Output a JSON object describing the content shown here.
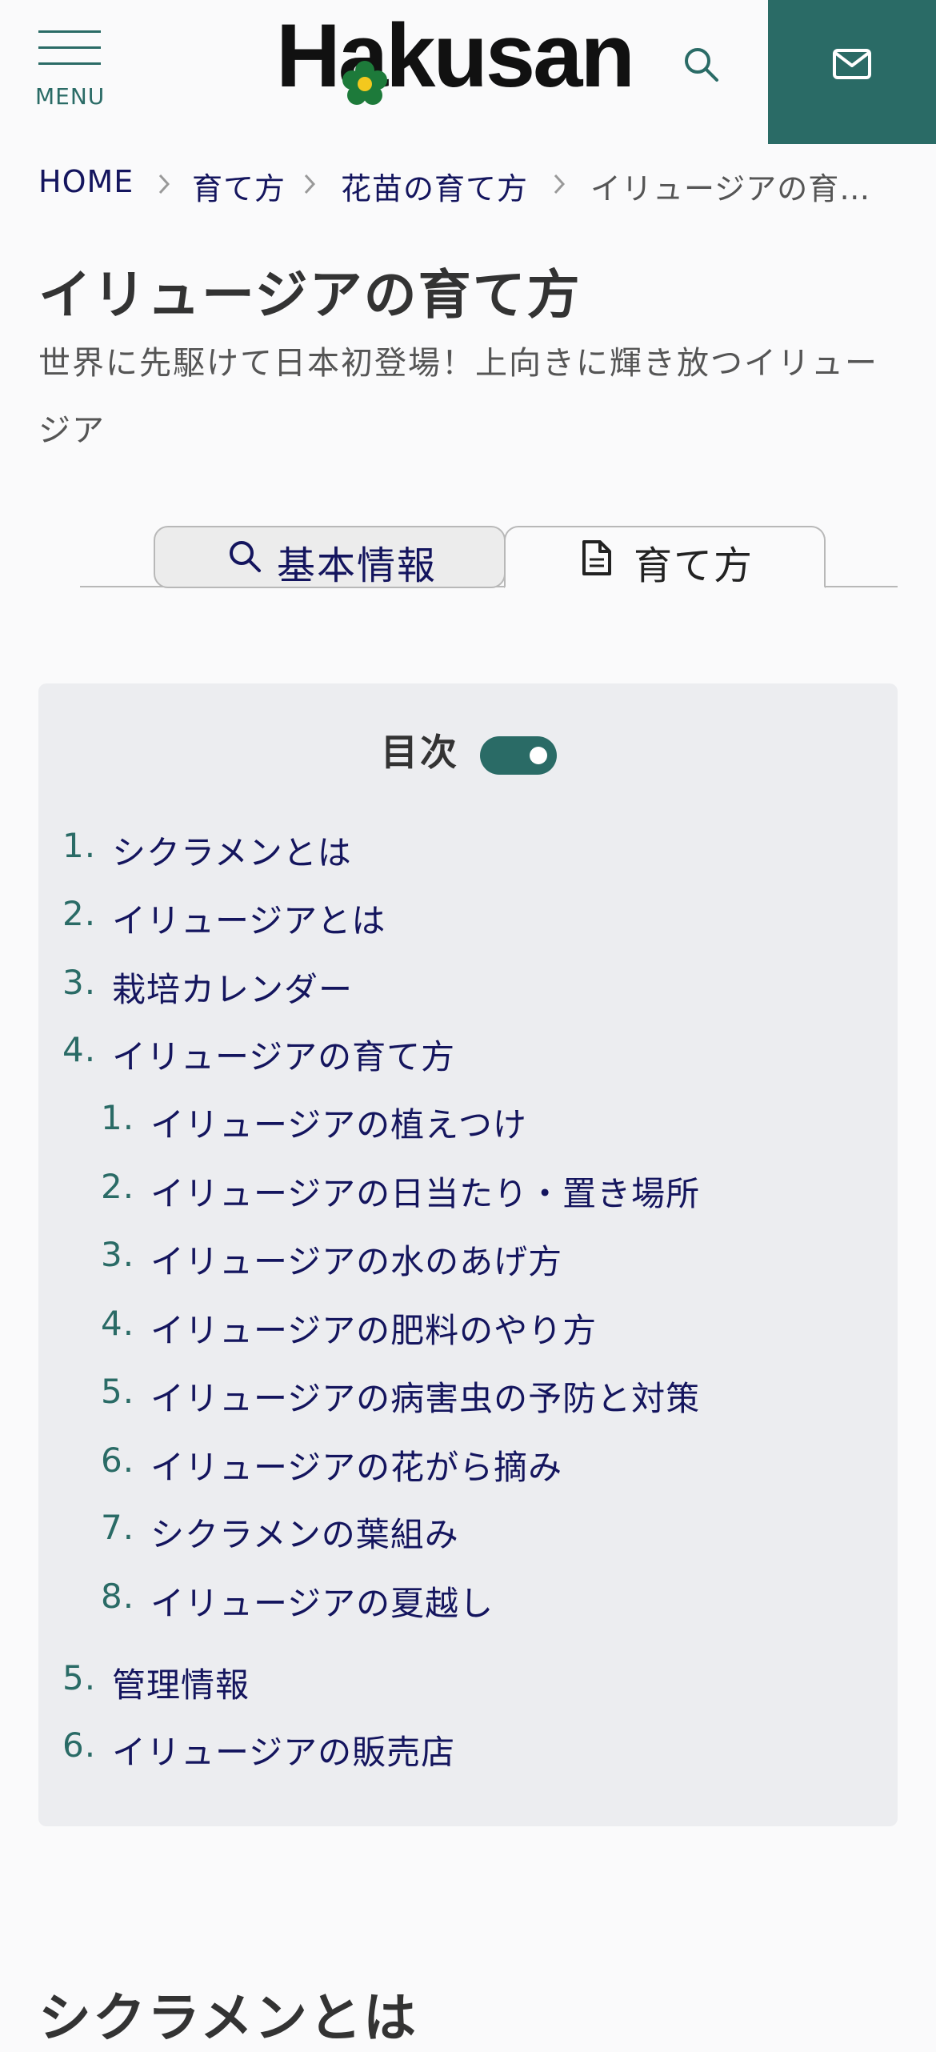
{
  "header": {
    "menu_label": "MENU",
    "logo_text": "Hakusan",
    "brand_color": "#2a6b66",
    "icons": [
      "menu-icon",
      "search-icon",
      "mail-icon"
    ]
  },
  "breadcrumb": [
    {
      "label": "HOME"
    },
    {
      "label": "育て方"
    },
    {
      "label": "花苗の育て方"
    },
    {
      "label": "イリュージアの育…"
    }
  ],
  "page": {
    "title": "イリュージアの育て方",
    "subtitle": "世界に先駆けて日本初登場！上向きに輝き放つイリュージア"
  },
  "tabs": [
    {
      "label": "基本情報",
      "icon": "search-icon",
      "active": false
    },
    {
      "label": "育て方",
      "icon": "document-icon",
      "active": true
    }
  ],
  "toc": {
    "heading": "目次",
    "toggle_on": true,
    "items": [
      {
        "num": "1.",
        "label": "シクラメンとは"
      },
      {
        "num": "2.",
        "label": "イリュージアとは"
      },
      {
        "num": "3.",
        "label": "栽培カレンダー"
      },
      {
        "num": "4.",
        "label": "イリュージアの育て方",
        "children": [
          {
            "num": "1.",
            "label": "イリュージアの植えつけ"
          },
          {
            "num": "2.",
            "label": "イリュージアの日当たり・置き場所"
          },
          {
            "num": "3.",
            "label": "イリュージアの水のあげ方"
          },
          {
            "num": "4.",
            "label": "イリュージアの肥料のやり方"
          },
          {
            "num": "5.",
            "label": "イリュージアの病害虫の予防と対策"
          },
          {
            "num": "6.",
            "label": "イリュージアの花がら摘み"
          },
          {
            "num": "7.",
            "label": "シクラメンの葉組み"
          },
          {
            "num": "8.",
            "label": "イリュージアの夏越し"
          }
        ]
      },
      {
        "num": "5.",
        "label": "管理情報"
      },
      {
        "num": "6.",
        "label": "イリュージアの販売店"
      }
    ]
  },
  "section": {
    "heading": "シクラメンとは"
  }
}
